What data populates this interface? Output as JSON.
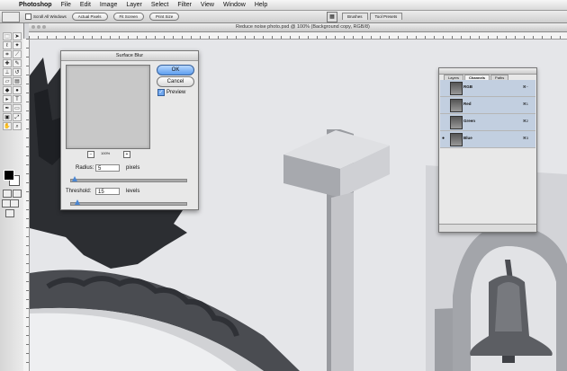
{
  "menubar": {
    "app_name": "Photoshop",
    "items": [
      "File",
      "Edit",
      "Image",
      "Layer",
      "Select",
      "Filter",
      "View",
      "Window",
      "Help"
    ]
  },
  "options_bar": {
    "scroll_all_windows": "Scroll All Windows",
    "actual_pixels": "Actual Pixels",
    "fit_screen": "Fit Screen",
    "print_size": "Print Size"
  },
  "dock_tabs": [
    "Brushes",
    "Tool Presets"
  ],
  "document": {
    "title": "Reduce noise photo.psd @ 100% (Background copy, RGB/8)"
  },
  "surface_blur": {
    "title": "Surface Blur",
    "ok_label": "OK",
    "cancel_label": "Cancel",
    "preview_label": "Preview",
    "preview_checked": true,
    "zoom": "100%",
    "radius_label": "Radius:",
    "radius_value": "5",
    "radius_unit": "pixels",
    "radius_fraction": 0.04,
    "threshold_label": "Threshold:",
    "threshold_value": "15",
    "threshold_unit": "levels",
    "threshold_fraction": 0.06
  },
  "channels_panel": {
    "tabs": [
      "Layers",
      "Channels",
      "Paths"
    ],
    "active_tab": "Channels",
    "channels": [
      {
        "name": "RGB",
        "key": "⌘~",
        "visible": false
      },
      {
        "name": "Red",
        "key": "⌘1",
        "visible": false
      },
      {
        "name": "Green",
        "key": "⌘2",
        "visible": false
      },
      {
        "name": "Blue",
        "key": "⌘3",
        "visible": true
      }
    ]
  },
  "colors": {
    "ok_button": "#5d9eee",
    "selected_channel": "#c2cfe0"
  }
}
